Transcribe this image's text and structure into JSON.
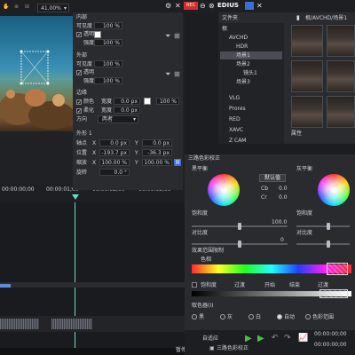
{
  "preview": {
    "zoom": "41.00%",
    "timecodes": [
      "00:00:00;00",
      "00:00:01;00",
      "00:00:02;00",
      "00:00:03;00"
    ]
  },
  "effect_panel": {
    "inner_label": "内部",
    "inner_opacity_label": "可见度",
    "inner_opacity_value": "100 %",
    "inner_transparent_label": "透明",
    "inner_strength_label": "强度",
    "inner_strength_value": "100 %",
    "outer_label": "外部",
    "outer_opacity_label": "可见度",
    "outer_opacity_value": "100 %",
    "outer_transparent_label": "透明",
    "outer_strength_label": "强度",
    "outer_strength_value": "100 %",
    "edge_label": "边缘",
    "edge_color_label": "颜色",
    "edge_width_label": "宽度",
    "edge_width_value": "0.0 px",
    "edge_color_value": "100 %",
    "soft_label": "柔化",
    "soft_width_label": "宽度",
    "soft_width_value": "0.0 px",
    "direction_label": "方向",
    "direction_value": "两者",
    "shape_label": "外形 1",
    "axis_label": "轴点",
    "axis_x": "0.0 px",
    "axis_y": "0.0 px",
    "pos_label": "位置",
    "pos_x": "-193.7 px",
    "pos_y": "-36.3 px",
    "scale_label": "缩放",
    "scale_x": "100.00 %",
    "scale_y": "100.00 %",
    "rotate_label": "旋转",
    "rotate_value": "0.0 °",
    "ok_label": "确定",
    "cancel_label": "取消"
  },
  "edius": {
    "title": "EDIUS",
    "rec": "REC",
    "folder_label": "文件夹",
    "path": "根/AVCHD/场景1",
    "tree": [
      "根",
      "AVCHD",
      "HDR",
      "场景1",
      "场景2",
      "镜头1",
      "场景3",
      "VLG",
      "Prores",
      "RED",
      "XAVC",
      "Z CAM"
    ],
    "attr_label": "属性",
    "preview_icon": "film-icon"
  },
  "color_correction": {
    "title": "三路色彩校正",
    "black_label": "黑平衡",
    "white_label": "灰平衡",
    "default_btn": "默认值",
    "cb_label": "Cb",
    "cr_label": "Cr",
    "cb_value": "0.0",
    "cr_value": "0.0",
    "saturation_label": "饱和度",
    "saturation_value": "100.0",
    "contrast_label": "对比度",
    "contrast_value": "0",
    "white_sat_label": "饱和度",
    "white_contrast_label": "对比度",
    "range_label": "效果范围限制",
    "hue_label": "色相",
    "sat_label": "饱和度",
    "fade_label": "过渡",
    "start_label": "开始",
    "end_label": "结束",
    "luma_label": "过渡",
    "checks": [
      "黑",
      "灰",
      "白",
      "自动",
      "色彩范围"
    ],
    "auto_label": "自适应",
    "timeline_labels": [
      "00:00:00;00",
      "00:00:00;00"
    ]
  },
  "bottom": {
    "gain_label": "自适应",
    "tab_label": "三路色彩校正",
    "pause_label": "暂停"
  }
}
